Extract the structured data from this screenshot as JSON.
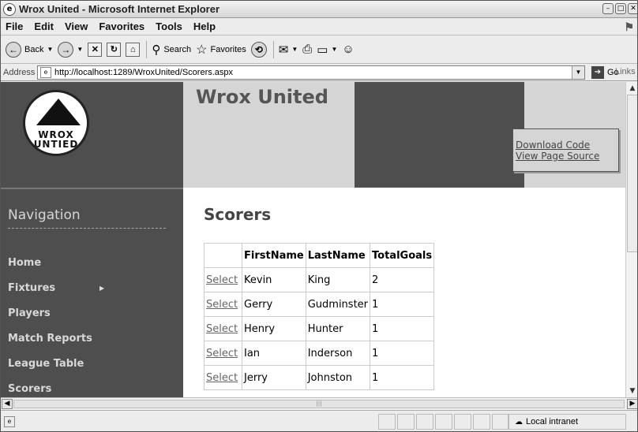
{
  "window": {
    "title": "Wrox United - Microsoft Internet Explorer"
  },
  "menu": [
    "File",
    "Edit",
    "View",
    "Favorites",
    "Tools",
    "Help"
  ],
  "toolbar": {
    "back": "Back",
    "search": "Search",
    "favorites": "Favorites"
  },
  "address": {
    "label": "Address",
    "url": "http://localhost:1289/WroxUnited/Scorers.aspx",
    "go": "Go",
    "links": "Links"
  },
  "site": {
    "logo_line1": "WROX",
    "logo_line2": "UNTIED",
    "title": "Wrox United"
  },
  "header_links": {
    "download": "Download Code",
    "view_source": "View Page Source"
  },
  "nav": {
    "title": "Navigation",
    "items": [
      "Home",
      "Fixtures",
      "Players",
      "Match Reports",
      "League Table",
      "Scorers"
    ]
  },
  "main": {
    "title": "Scorers",
    "columns": [
      "FirstName",
      "LastName",
      "TotalGoals"
    ],
    "select_label": "Select",
    "rows": [
      [
        "Kevin",
        "King",
        "2"
      ],
      [
        "Gerry",
        "Gudminster",
        "1"
      ],
      [
        "Henry",
        "Hunter",
        "1"
      ],
      [
        "Ian",
        "Inderson",
        "1"
      ],
      [
        "Jerry",
        "Johnston",
        "1"
      ]
    ]
  },
  "status": {
    "zone": "Local intranet"
  }
}
